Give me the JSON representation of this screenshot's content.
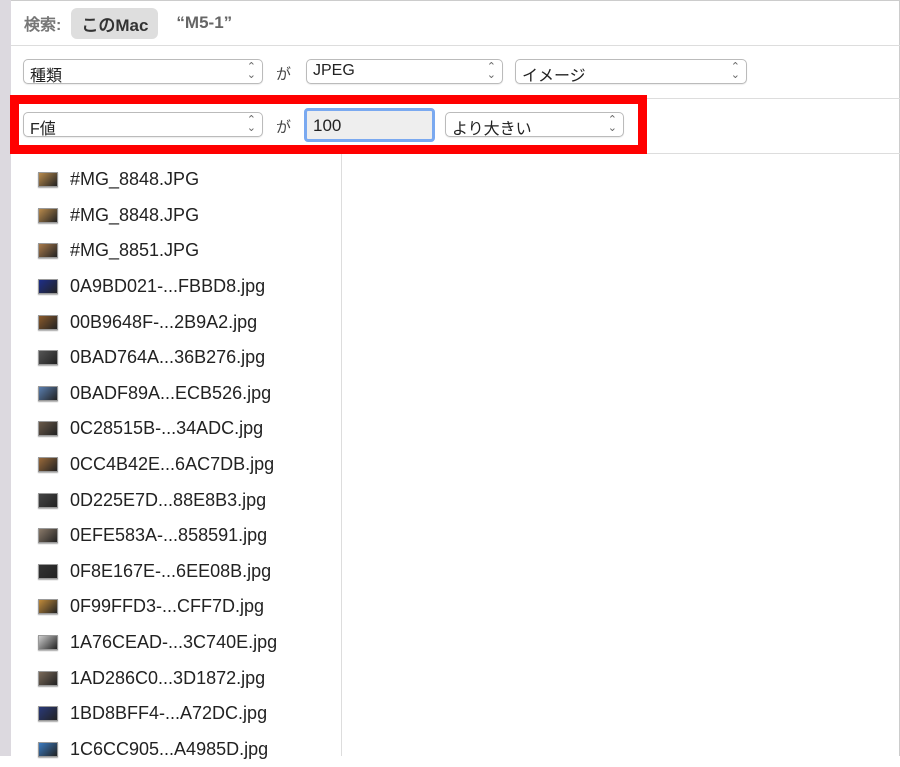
{
  "search": {
    "label": "検索:",
    "scope": "このMac",
    "query": "“M5-1”"
  },
  "criteria": [
    {
      "attribute": "種類",
      "operator": "が",
      "value": "JPEG",
      "sub": "イメージ"
    },
    {
      "attribute": "F値",
      "operator": "が",
      "value": "100",
      "comparison": "より大きい"
    }
  ],
  "files": [
    {
      "name": "#MG_8848.JPG",
      "color": "#b88a4c"
    },
    {
      "name": "#MG_8848.JPG",
      "color": "#b88a4c"
    },
    {
      "name": "#MG_8851.JPG",
      "color": "#a97a4a"
    },
    {
      "name": "0A9BD021-...FBBD8.jpg",
      "color": "#1e2f8a"
    },
    {
      "name": "00B9648F-...2B9A2.jpg",
      "color": "#8a5a2c"
    },
    {
      "name": "0BAD764A...36B276.jpg",
      "color": "#555555"
    },
    {
      "name": "0BADF89A...ECB526.jpg",
      "color": "#5a7fb0"
    },
    {
      "name": "0C28515B-...34ADC.jpg",
      "color": "#6a5a4a"
    },
    {
      "name": "0CC4B42E...6AC7DB.jpg",
      "color": "#9a6a3a"
    },
    {
      "name": "0D225E7D...88E8B3.jpg",
      "color": "#444444"
    },
    {
      "name": "0EFE583A-...858591.jpg",
      "color": "#8a7a6a"
    },
    {
      "name": "0F8E167E-...6EE08B.jpg",
      "color": "#333333"
    },
    {
      "name": "0F99FFD3-...CFF7D.jpg",
      "color": "#c08a3a"
    },
    {
      "name": "1A76CEAD-...3C740E.jpg",
      "color": "#cccccc"
    },
    {
      "name": "1AD286C0...3D1872.jpg",
      "color": "#7a6a5a"
    },
    {
      "name": "1BD8BFF4-...A72DC.jpg",
      "color": "#2a3a7a"
    },
    {
      "name": "1C6CC905...A4985D.jpg",
      "color": "#3a7ac0"
    }
  ]
}
